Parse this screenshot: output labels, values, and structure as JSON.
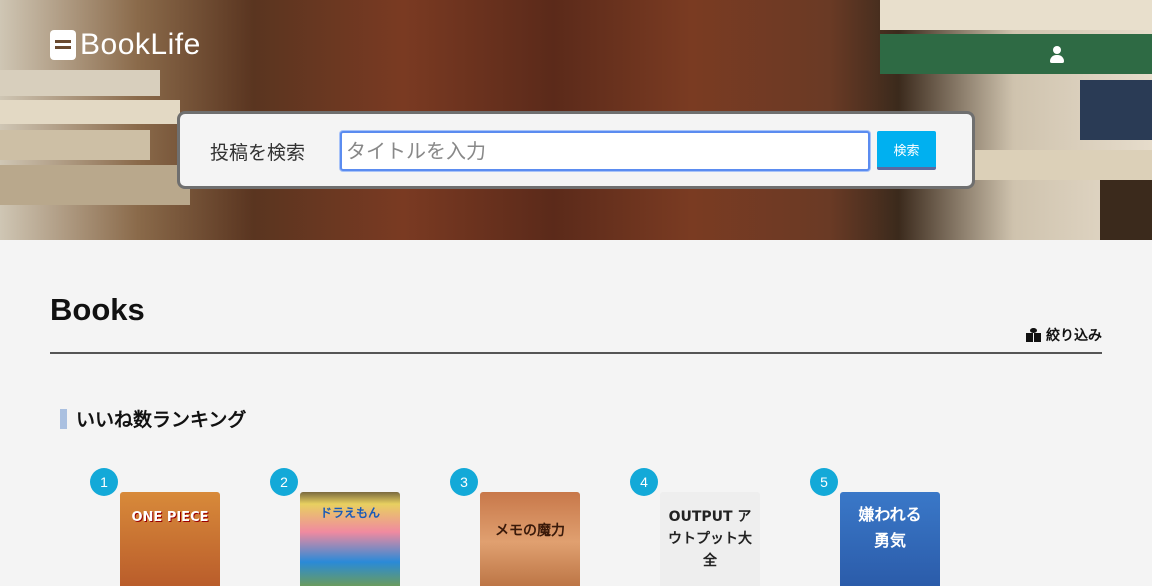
{
  "app": {
    "title": "BookLife"
  },
  "search": {
    "label": "投稿を検索",
    "placeholder": "タイトルを入力",
    "button_label": "検索"
  },
  "main": {
    "title": "Books",
    "filter_label": "絞り込み"
  },
  "ranking": {
    "title": "いいね数ランキング",
    "items": [
      {
        "rank": "1",
        "cover_text": "ONE PIECE"
      },
      {
        "rank": "2",
        "cover_text": "ドラえもん"
      },
      {
        "rank": "3",
        "cover_text": "メモの魔力"
      },
      {
        "rank": "4",
        "cover_text": "OUTPUT アウトプット大全"
      },
      {
        "rank": "5",
        "cover_text": "嫌われる勇気"
      }
    ]
  },
  "colors": {
    "accent": "#00b0f0",
    "badge": "#13a9d8",
    "section_bar": "#aac0e0"
  }
}
